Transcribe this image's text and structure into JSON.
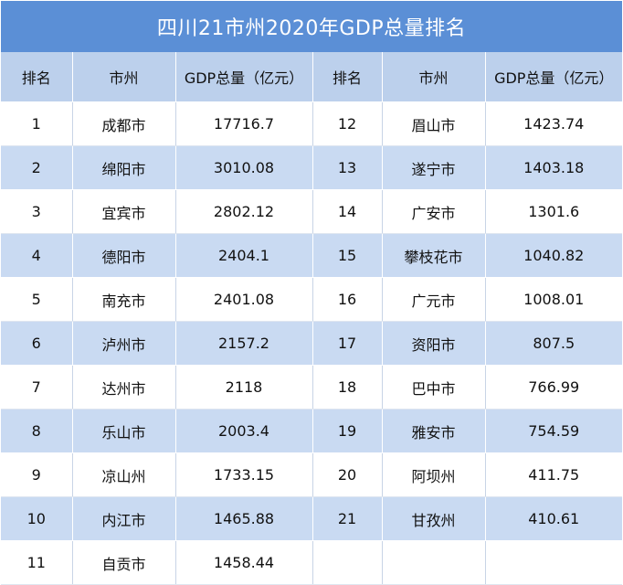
{
  "title": "四川21市州2020年GDP总量排名",
  "headers": [
    "排名",
    "市州",
    "GDP总量（亿元）",
    "排名",
    "市州",
    "GDP总量（亿元）"
  ],
  "rows": [
    [
      "1",
      "成都市",
      "17716.7",
      "12",
      "眉山市",
      "1423.74"
    ],
    [
      "2",
      "绵阳市",
      "3010.08",
      "13",
      "遂宁市",
      "1403.18"
    ],
    [
      "3",
      "宜宾市",
      "2802.12",
      "14",
      "广安市",
      "1301.6"
    ],
    [
      "4",
      "德阳市",
      "2404.1",
      "15",
      "攀枝花市",
      "1040.82"
    ],
    [
      "5",
      "南充市",
      "2401.08",
      "16",
      "广元市",
      "1008.01"
    ],
    [
      "6",
      "泸州市",
      "2157.2",
      "17",
      "资阳市",
      "807.5"
    ],
    [
      "7",
      "达州市",
      "2118",
      "18",
      "巴中市",
      "766.99"
    ],
    [
      "8",
      "乐山市",
      "2003.4",
      "19",
      "雅安市",
      "754.59"
    ],
    [
      "9",
      "凉山州",
      "1733.15",
      "20",
      "阿坝州",
      "411.75"
    ],
    [
      "10",
      "内江市",
      "1465.88",
      "21",
      "甘孜州",
      "410.61"
    ],
    [
      "11",
      "自贡市",
      "1458.44",
      "",
      "",
      ""
    ]
  ],
  "colors": {
    "title_bg": "#5b8fd6",
    "header_bg": "#bcd0ec",
    "stripe_bg": "#c9daf2"
  }
}
